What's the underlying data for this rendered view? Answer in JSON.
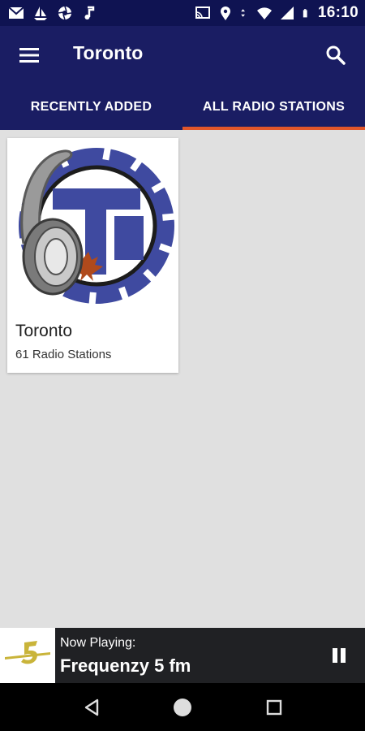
{
  "status_bar": {
    "time": "16:10",
    "icons": [
      "mail-icon",
      "sailboat-icon",
      "aperture-icon",
      "music-note-icon",
      "cast-icon",
      "location-icon",
      "data-arrows-icon",
      "wifi-icon",
      "signal-icon",
      "battery-icon"
    ]
  },
  "app_bar": {
    "title": "Toronto",
    "menu_icon": "hamburger-menu-icon",
    "search_icon": "search-icon"
  },
  "tabs": [
    {
      "label": "RECENTLY ADDED",
      "active": false
    },
    {
      "label": "ALL RADIO STATIONS",
      "active": true
    }
  ],
  "colors": {
    "status_bar": "#0f1352",
    "app_bar": "#1a1d63",
    "tab_indicator": "#e2562a",
    "background": "#e0e0e0",
    "player": "#202124"
  },
  "cards": [
    {
      "title": "Toronto",
      "subtitle": "61 Radio Stations",
      "image": "toronto-headphones-logo"
    }
  ],
  "now_playing": {
    "label": "Now Playing:",
    "station": "Frequenzy 5 fm",
    "control_icon": "pause-icon"
  },
  "nav_bar": {
    "icons": [
      "back-icon",
      "home-icon",
      "recents-icon"
    ]
  }
}
